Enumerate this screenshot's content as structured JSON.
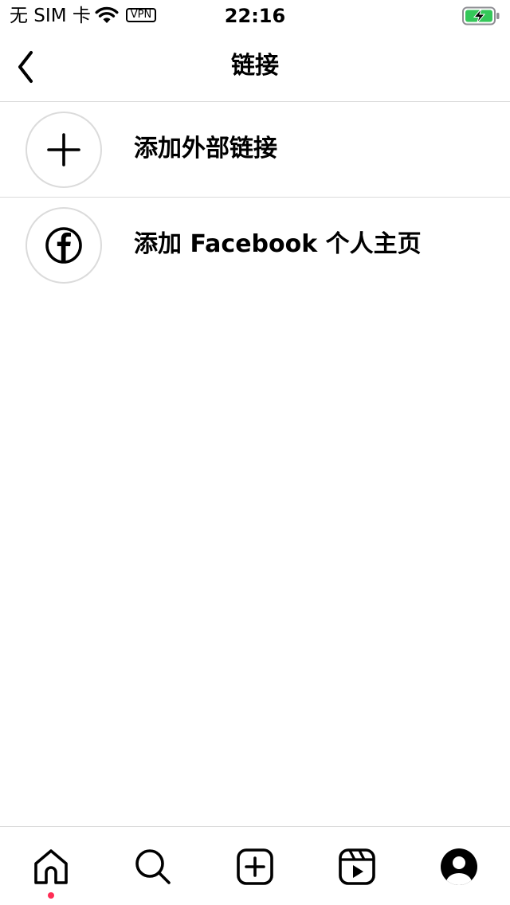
{
  "status_bar": {
    "carrier": "无 SIM 卡",
    "vpn": "VPN",
    "time": "22:16",
    "battery_color": "#34c759"
  },
  "header": {
    "title": "链接"
  },
  "items": [
    {
      "label": "添加外部链接",
      "icon": "plus-icon"
    },
    {
      "label": "添加 Facebook 个人主页",
      "icon": "facebook-icon"
    }
  ],
  "tab_bar": {
    "tabs": [
      "home-icon",
      "search-icon",
      "create-icon",
      "reels-icon",
      "profile-icon"
    ],
    "active": "home-icon",
    "notification_dot_color": "#ff2d55"
  },
  "colors": {
    "divider": "#dbdbdb",
    "text": "#000000"
  }
}
